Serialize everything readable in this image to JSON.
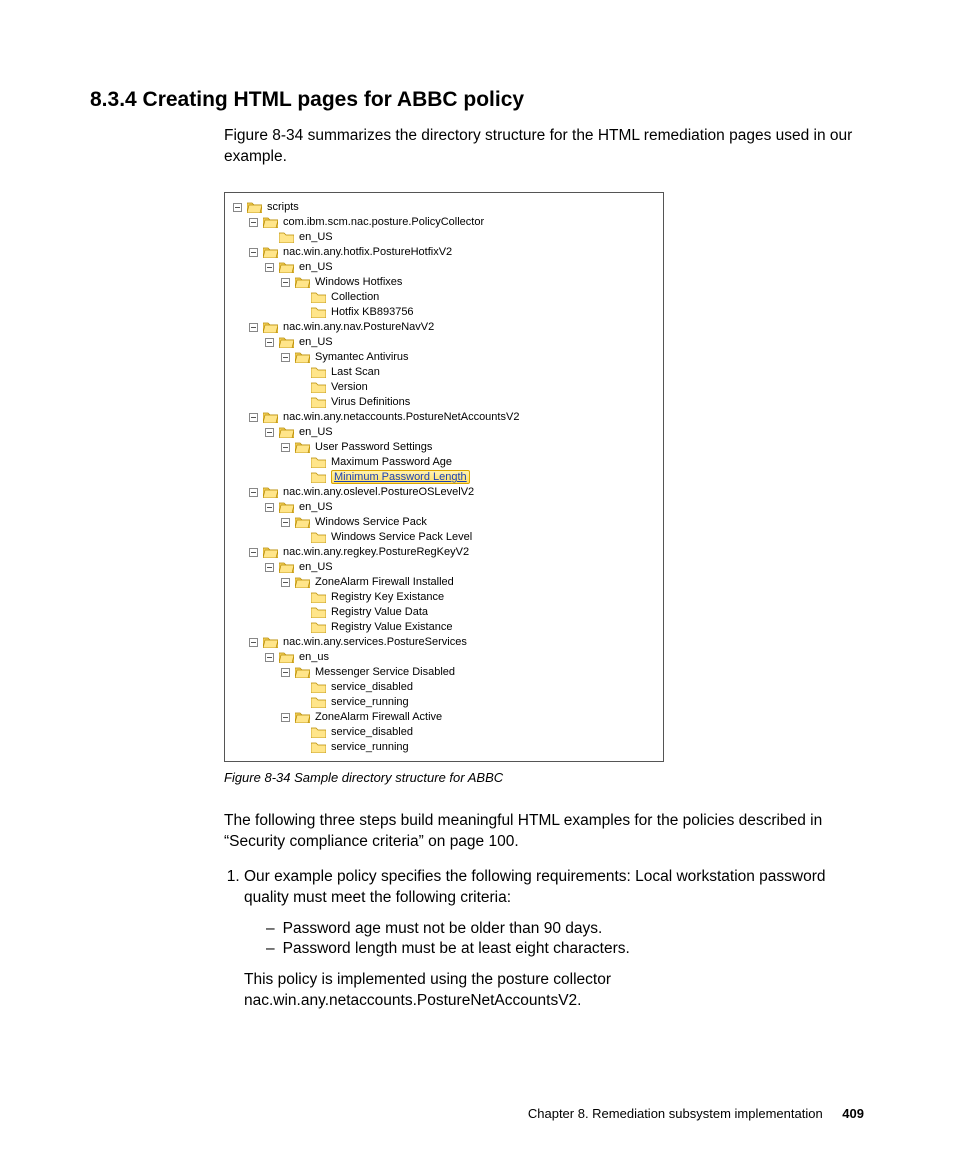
{
  "heading": "8.3.4  Creating HTML pages for ABBC policy",
  "intro": "Figure 8-34 summarizes the directory structure for the HTML remediation pages used in our example.",
  "tree": {
    "root": "scripts",
    "n_policycollector": "com.ibm.scm.nac.posture.PolicyCollector",
    "en_us": "en_US",
    "en_us_lc": "en_us",
    "n_hotfix": "nac.win.any.hotfix.PostureHotfixV2",
    "win_hotfixes": "Windows Hotfixes",
    "collection": "Collection",
    "hotfix_kb": "Hotfix KB893756",
    "n_nav": "nac.win.any.nav.PostureNavV2",
    "symantec": "Symantec Antivirus",
    "last_scan": "Last Scan",
    "version": "Version",
    "virus_def": "Virus Definitions",
    "n_netacct": "nac.win.any.netaccounts.PostureNetAccountsV2",
    "user_pw": "User Password Settings",
    "max_pw_age": "Maximum Password Age",
    "min_pw_len": "Minimum Password Length",
    "n_oslevel": "nac.win.any.oslevel.PostureOSLevelV2",
    "win_sp": "Windows Service Pack",
    "win_sp_lvl": "Windows Service Pack Level",
    "n_regkey": "nac.win.any.regkey.PostureRegKeyV2",
    "za_inst": "ZoneAlarm Firewall Installed",
    "reg_key_ex": "Registry Key Existance",
    "reg_val_data": "Registry Value Data",
    "reg_val_ex": "Registry Value Existance",
    "n_services": "nac.win.any.services.PostureServices",
    "msg_disabled": "Messenger Service Disabled",
    "svc_disabled": "service_disabled",
    "svc_running": "service_running",
    "za_active": "ZoneAlarm Firewall Active"
  },
  "caption": "Figure 8-34   Sample directory structure for ABBC",
  "para2": "The following three steps build meaningful HTML examples for the policies described in “Security compliance criteria” on page 100.",
  "step1_a": "Our example policy specifies the following requirements: Local workstation password quality must meet the following criteria:",
  "step1_b1": "Password age must not be older than 90 days.",
  "step1_b2": "Password length must be at least eight characters.",
  "step1_c": "This policy is implemented using the posture collector nac.win.any.netaccounts.PostureNetAccountsV2.",
  "footer_chapter": "Chapter 8. Remediation subsystem implementation",
  "footer_page": "409"
}
